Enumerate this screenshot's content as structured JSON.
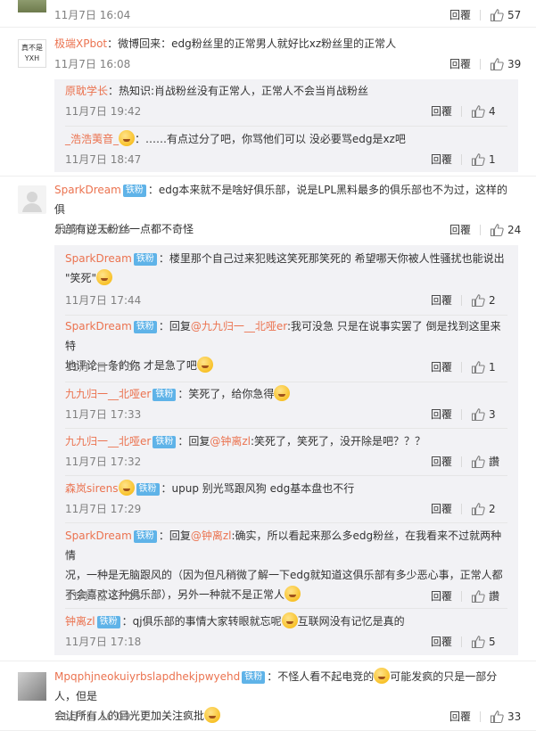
{
  "top_item": {
    "time": "11月7日 16:04",
    "reply": "回覆",
    "likes": "57"
  },
  "comments": [
    {
      "user": "极端XPbot",
      "avatar_text": "真不是 YXH",
      "badge": "",
      "text": "：微博回来：edg粉丝里的正常男人就好比xz粉丝里的正常人",
      "time": "11月7日 16:08",
      "reply": "回覆",
      "likes": "39",
      "replies": [
        {
          "user": "原耽学长",
          "badge": "",
          "text": "：热知识:肖战粉丝没有正常人，正常人不会当肖战粉丝",
          "time": "11月7日 19:42",
          "reply": "回覆",
          "likes": "4"
        },
        {
          "user": "_浩浩荑音_",
          "badge": "",
          "text": "：……有点过分了吧，你骂他们可以  没必要骂edg是xz吧",
          "time": "11月7日 18:47",
          "reply": "回覆",
          "likes": "1"
        }
      ]
    },
    {
      "user": "SparkDream",
      "badge": "铁粉",
      "text1": "：edg本来就不是啥好俱乐部，说是LPL黑料最多的俱乐部也不为过，这样的俱",
      "text2": "乐部有逆天粉丝一点都不奇怪",
      "time": "11月7日 16:16",
      "reply": "回覆",
      "likes": "24",
      "replies": [
        {
          "user": "SparkDream",
          "badge": "铁粉",
          "text1": "：楼里那个自己过来犯贱这笑死那笑死的 希望哪天你被人性骚扰也能说出",
          "text2": "\"笑死\"",
          "time": "11月7日 17:44",
          "reply": "回覆",
          "likes": "2"
        },
        {
          "user": "SparkDream",
          "badge": "铁粉",
          "prefix": "：回复",
          "mention": "@九九归一__北哑er",
          "text1": ":我可没急 只是在说事实罢了 倒是找到这里来特",
          "text2": "地评论一条的你 才是急了吧",
          "time": "11月7日 17:35",
          "reply": "回覆",
          "likes": "1"
        },
        {
          "user": "九九归一__北哑er",
          "badge": "铁粉",
          "text": "：笑死了，给你急得",
          "time": "11月7日 17:33",
          "reply": "回覆",
          "likes": "3"
        },
        {
          "user": "九九归一__北哑er",
          "badge": "铁粉",
          "prefix": "：回复",
          "mention": "@钟离zl",
          "text": ":笑死了，笑死了，没开除是吧？？？",
          "time": "11月7日 17:32",
          "reply": "回覆",
          "likes": "讚"
        },
        {
          "user": "森岚sirens",
          "badge": "铁粉",
          "text": "：upup 别光骂跟风狗 edg基本盘也不行",
          "time": "11月7日 17:29",
          "reply": "回覆",
          "likes": "2"
        },
        {
          "user": "SparkDream",
          "badge": "铁粉",
          "prefix": "：回复",
          "mention": "@钟离zl",
          "text1": ":确实，所以看起来那么多edg粉丝，在我看来不过就两种情",
          "text2": "况，一种是无脑跟风的（因为但凡稍微了解一下edg就知道这俱乐部有多少恶心事，正常人都",
          "text3": "不会喜欢这种俱乐部），另外一种就不是正常人",
          "time": "11月7日 17:25",
          "reply": "回覆",
          "likes": "讚"
        },
        {
          "user": "钟离zl",
          "badge": "铁粉",
          "text1": "：qj俱乐部的事情大家转眼就忘呢",
          "text2": "互联网没有记忆是真的",
          "time": "11月7日 17:18",
          "reply": "回覆",
          "likes": "5"
        }
      ]
    },
    {
      "user": "Mpqphjneokuiyrbslapdhekjpwyehd",
      "badge": "铁粉",
      "text1": "：不怪人看不起电竞的",
      "text1b": "可能发疯的只是一部分人，但是",
      "text2": "会让所有人的目光更加关注疯批",
      "time": "11月7日 16:09",
      "reply": "回覆",
      "likes": "33"
    }
  ],
  "colors": {
    "username": "#eb7350",
    "badge": "#5fb3e8",
    "reply_bg": "#f2f2f5"
  }
}
